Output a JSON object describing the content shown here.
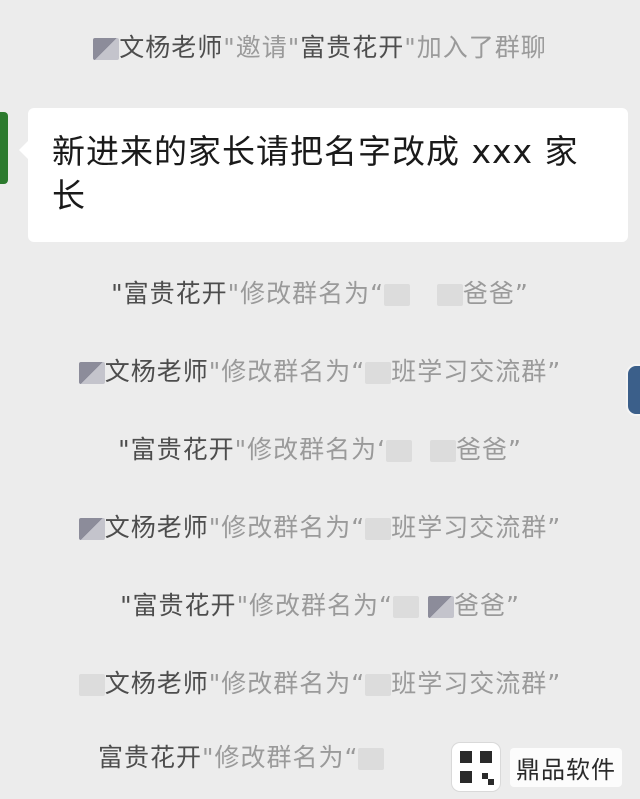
{
  "messages": {
    "invite": {
      "inviter": "文杨老师",
      "verb": "\"邀请\"",
      "invitee": "富贵花开",
      "tail": "\"加入了群聊"
    },
    "bubble_text": "新进来的家长请把名字改成 xxx 家长",
    "lines": [
      {
        "name": "\"富贵花开",
        "mid": "\"修改群名为“",
        "end": "爸爸”"
      },
      {
        "name": "文杨老师",
        "mid": "\"修改群名为“",
        "end": "班学习交流群”"
      },
      {
        "name": "\"富贵花开",
        "mid": "\"修改群名为‘",
        "end": "爸爸”"
      },
      {
        "name": "文杨老师",
        "mid": "\"修改群名为“",
        "end": "班学习交流群”"
      },
      {
        "name": "\"富贵花开",
        "mid": "\"修改群名为“",
        "end": "爸爸”"
      },
      {
        "name": "文杨老师",
        "mid": "\"修改群名为“",
        "end": "班学习交流群”"
      },
      {
        "name": "富贵花开",
        "mid": "\"修改群名为“",
        "end": ""
      }
    ]
  },
  "watermark": {
    "text": "鼎品软件",
    "icon": "qr-logo-icon"
  }
}
